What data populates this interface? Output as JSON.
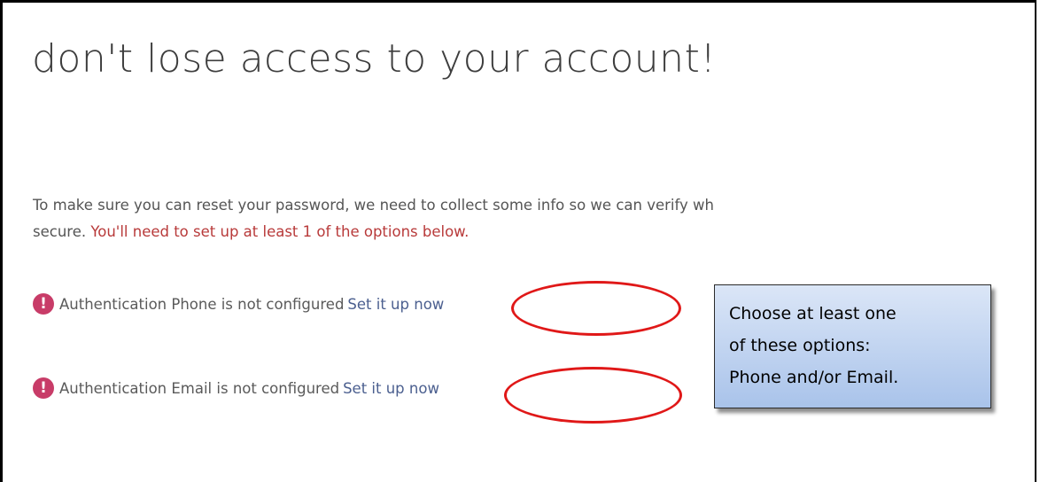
{
  "page": {
    "title": "don't lose access to your account!"
  },
  "intro": {
    "line1": "To make sure you can reset your password, we need to collect some info so we can verify wh",
    "line2_prefix": "secure. ",
    "line2_required": "You'll need to set up at least 1 of the options below."
  },
  "options": [
    {
      "icon": "exclamation-icon",
      "status": "Authentication Phone is not configured",
      "link": "Set it up now"
    },
    {
      "icon": "exclamation-icon",
      "status": "Authentication Email is not configured",
      "link": "Set it up now"
    }
  ],
  "callout": {
    "lines": [
      "Choose at least one",
      "of these options:",
      "Phone and/or Email."
    ]
  },
  "colors": {
    "required_text": "#b83a3a",
    "warning_icon": "#c83c68",
    "link": "#4b5f8f",
    "highlight_oval": "#e01818"
  }
}
